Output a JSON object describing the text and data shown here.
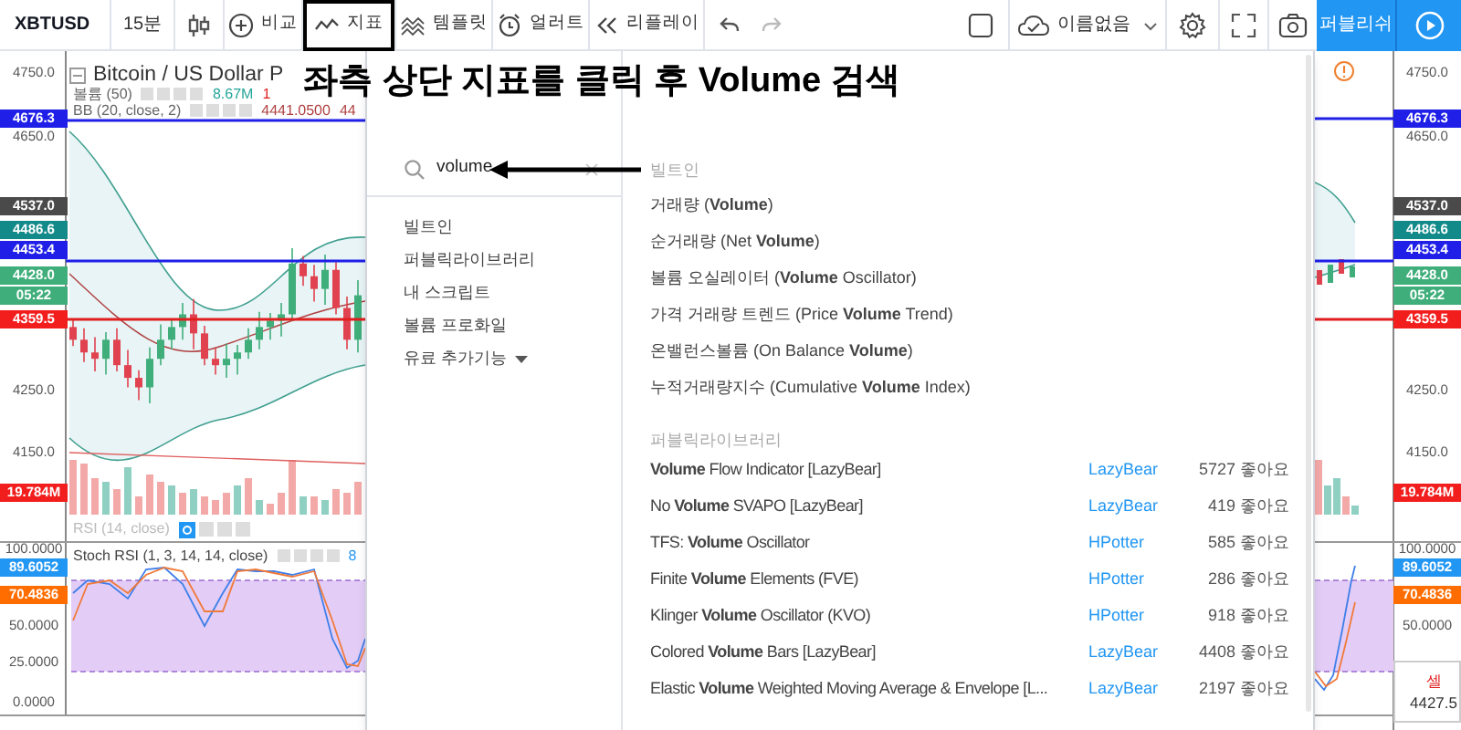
{
  "toolbar": {
    "symbol": "XBTUSD",
    "interval": "15분",
    "buttons": [
      {
        "label": "비교",
        "highlighted": false
      },
      {
        "label": "지표",
        "highlighted": true
      },
      {
        "label": "템플릿",
        "highlighted": false
      },
      {
        "label": "얼러트",
        "highlighted": false
      },
      {
        "label": "리플레이",
        "highlighted": false
      }
    ],
    "layout_name": "이름없음",
    "publish_button": "퍼블리쉬"
  },
  "annotation": {
    "caption": "좌측 상단 지표를 클릭 후 Volume 검색"
  },
  "chart_left": {
    "legend": {
      "title": "Bitcoin / US Dollar P",
      "volume_label": "볼륨 (50)",
      "volume_value": "8.67M",
      "volume_change": "1",
      "bb_label": "BB (20, close, 2)",
      "bb_value": "4441.0500",
      "bb_value_2": "44"
    },
    "price_labels": [
      {
        "text": "4750.0"
      },
      {
        "text": "4676.3",
        "color": "#1f1fe8"
      },
      {
        "text": "4650.0"
      },
      {
        "text": "4537.0",
        "color": "#4a4a4a"
      },
      {
        "text": "4486.6",
        "color": "#138a8a"
      },
      {
        "text": "4453.4",
        "color": "#1f1fe8"
      },
      {
        "text": "4428.0",
        "color": "#3fae7a"
      },
      {
        "text": "05:22",
        "color": "#3fae7a"
      },
      {
        "text": "4359.5",
        "color": "#f21e1e"
      },
      {
        "text": "4250.0"
      },
      {
        "text": "4150.0"
      },
      {
        "text": "19.784M",
        "color": "#f21e1e"
      }
    ],
    "rsi_label": "RSI (14, close)",
    "stoch_label": "Stoch RSI (1, 3, 14, 14, close)",
    "stoch_value": "8",
    "stoch_labels": [
      {
        "text": "100.0000"
      },
      {
        "text": "89.6052",
        "color": "#2196f3"
      },
      {
        "text": "70.4836",
        "color": "#ff6d00"
      },
      {
        "text": "50.0000"
      },
      {
        "text": "25.0000"
      },
      {
        "text": "0.0000"
      }
    ]
  },
  "chart_right": {
    "price_labels": [
      {
        "text": "4750.0"
      },
      {
        "text": "4676.3",
        "color": "#1f1fe8"
      },
      {
        "text": "4650.0"
      },
      {
        "text": "4537.0",
        "color": "#4a4a4a"
      },
      {
        "text": "4486.6",
        "color": "#138a8a"
      },
      {
        "text": "4453.4",
        "color": "#1f1fe8"
      },
      {
        "text": "4428.0",
        "color": "#3fae7a"
      },
      {
        "text": "05:22",
        "color": "#3fae7a"
      },
      {
        "text": "4359.5",
        "color": "#f21e1e"
      },
      {
        "text": "4250.0"
      },
      {
        "text": "4150.0"
      },
      {
        "text": "19.784M",
        "color": "#f21e1e"
      }
    ],
    "stoch_labels": [
      {
        "text": "100.0000"
      },
      {
        "text": "89.6052",
        "color": "#2196f3"
      },
      {
        "text": "70.4836",
        "color": "#ff6d00"
      },
      {
        "text": "50.0000"
      }
    ],
    "order_box": {
      "side": "셀",
      "price": "4427.5"
    }
  },
  "indicator_dialog": {
    "search": {
      "value": "volume"
    },
    "categories": [
      {
        "label": "빌트인",
        "dropdown": false
      },
      {
        "label": "퍼블릭라이브러리",
        "dropdown": false
      },
      {
        "label": "내 스크립트",
        "dropdown": false
      },
      {
        "label": "볼륨 프로화일",
        "dropdown": false
      },
      {
        "label": "유료 추가기능",
        "dropdown": true
      }
    ],
    "sections": [
      {
        "title": "빌트인",
        "items": [
          {
            "name": "거래량 (**Volume**)"
          },
          {
            "name": "순거래량 (Net **Volume**)"
          },
          {
            "name": "볼륨 오실레이터 (**Volume** Oscillator)"
          },
          {
            "name": "가격 거래량 트렌드 (Price **Volume** Trend)"
          },
          {
            "name": "온밸런스볼륨 (On Balance **Volume**)"
          },
          {
            "name": "누적거래량지수 (Cumulative **Volume** Index)"
          }
        ]
      },
      {
        "title": "퍼블릭라이브러리",
        "items": [
          {
            "name": "**Volume** Flow Indicator [LazyBear]",
            "author": "LazyBear",
            "likes": "5727 좋아요"
          },
          {
            "name": "No **Volume** SVAPO [LazyBear]",
            "author": "LazyBear",
            "likes": "419 좋아요"
          },
          {
            "name": "TFS: **Volume** Oscillator",
            "author": "HPotter",
            "likes": "585 좋아요"
          },
          {
            "name": "Finite **Volume** Elements (FVE)",
            "author": "HPotter",
            "likes": "286 좋아요"
          },
          {
            "name": "Klinger **Volume** Oscillator (KVO)",
            "author": "HPotter",
            "likes": "918 좋아요"
          },
          {
            "name": "Colored **Volume** Bars [LazyBear]",
            "author": "LazyBear",
            "likes": "4408 좋아요"
          },
          {
            "name": "Elastic **Volume** Weighted Moving Average & Envelope [L...",
            "author": "LazyBear",
            "likes": "2197 좋아요"
          }
        ]
      }
    ]
  }
}
